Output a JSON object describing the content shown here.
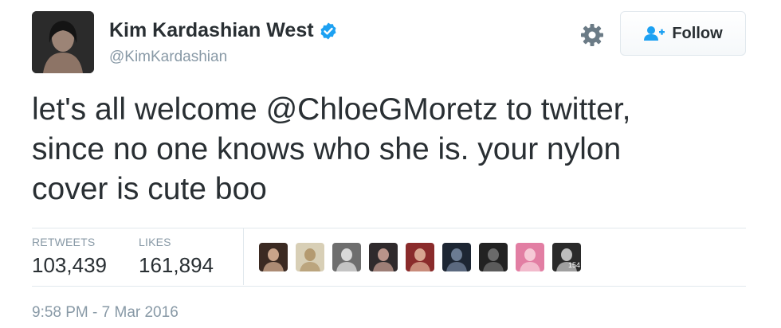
{
  "user": {
    "display_name": "Kim Kardashian West",
    "handle": "@KimKardashian",
    "verified": true,
    "avatar_icon": "profile-photo"
  },
  "actions": {
    "settings_icon": "gear-icon",
    "follow_label": "Follow",
    "follow_icon": "add-user-icon"
  },
  "tweet": {
    "lines": [
      {
        "before": "let's all welcome ",
        "mention": "@ChloeGMoretz",
        "after": " to twitter,"
      },
      {
        "text": "since no one knows who she is. your nylon"
      },
      {
        "text": "cover is cute boo"
      }
    ]
  },
  "stats": {
    "retweets_label": "RETWEETS",
    "retweets_value": "103,439",
    "likes_label": "LIKES",
    "likes_value": "161,894"
  },
  "likers": [
    {
      "name": "liker-avatar-1",
      "colors": [
        "#3b2a22",
        "#c9a48a"
      ]
    },
    {
      "name": "liker-avatar-2",
      "colors": [
        "#d8cfb6",
        "#b49a70"
      ]
    },
    {
      "name": "liker-avatar-3",
      "colors": [
        "#6e6e6e",
        "#d9d9d9"
      ]
    },
    {
      "name": "liker-avatar-4",
      "colors": [
        "#2f2a2c",
        "#b9948a"
      ]
    },
    {
      "name": "liker-avatar-5",
      "colors": [
        "#8a2b2b",
        "#d8a590"
      ]
    },
    {
      "name": "liker-avatar-6",
      "colors": [
        "#1d2633",
        "#6b7b92"
      ]
    },
    {
      "name": "liker-avatar-7",
      "colors": [
        "#222222",
        "#6a6a6a"
      ]
    },
    {
      "name": "liker-avatar-8",
      "colors": [
        "#e27ea3",
        "#f6c9d6"
      ]
    },
    {
      "name": "liker-avatar-9",
      "colors": [
        "#2a2a2a",
        "#bdbdbd"
      ],
      "overlay": "154"
    }
  ],
  "timestamp": "9:58 PM - 7 Mar 2016",
  "colors": {
    "text": "#292f33",
    "muted": "#8899a6",
    "verified_blue": "#1da1f2",
    "follow_icon_blue": "#1da1f2",
    "divider": "#e1e8ed"
  }
}
